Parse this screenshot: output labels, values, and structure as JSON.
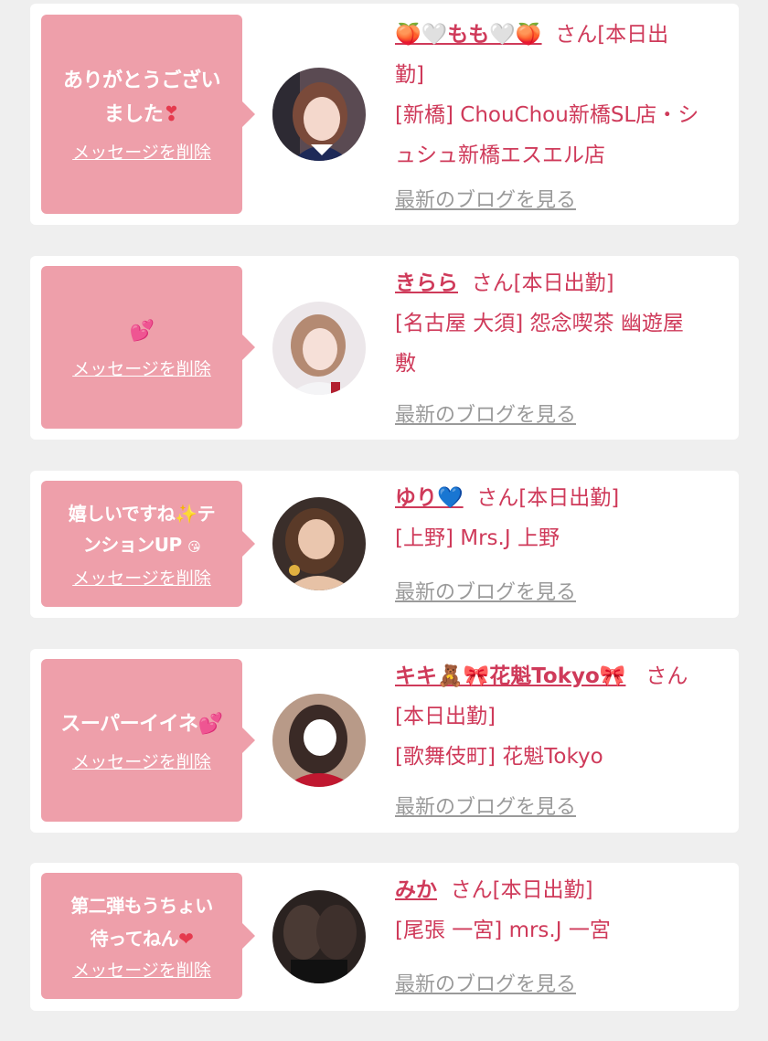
{
  "delete_label": "メッセージを削除",
  "blog_label": "最新のブログを見る",
  "san_label": "さん",
  "cards": [
    {
      "message_line1": "ありがとうござい",
      "message_line2": "ました",
      "message_emoji": "❣",
      "name": "🍑🤍もも🤍🍑",
      "status": "[本日出",
      "status2": "勤]",
      "shop_line1": "[新橋] ChouChou新橋SL店・シ",
      "shop_line2": "ュシュ新橋エスエル店",
      "avatar_icon": "avatar-photo-icon"
    },
    {
      "message_emoji": "💕",
      "name": "きらら",
      "status": "[本日出勤]",
      "shop_line1": "[名古屋 大須] 怨念喫茶 幽遊屋",
      "shop_line2": "敷",
      "avatar_icon": "avatar-photo-icon"
    },
    {
      "message_line1": "嬉しいですね",
      "message_emoji1": "✨",
      "message_line1b": "テ",
      "message_line2": "ンションUP",
      "message_emoji2": "😘",
      "name": "ゆり",
      "name_emoji": "💙",
      "status": "[本日出勤]",
      "shop_line1": "[上野] Mrs.J 上野",
      "avatar_icon": "avatar-photo-icon"
    },
    {
      "message_line1": "スーパーイイネ",
      "message_emoji": "💕",
      "name": "キキ🧸🎀花魁Tokyo🎀",
      "status": "",
      "status2": "[本日出勤]",
      "shop_line1": "[歌舞伎町] 花魁Tokyo",
      "avatar_icon": "avatar-photo-icon"
    },
    {
      "message_line1": "第二弾もうちょい",
      "message_line2": "待ってねん",
      "message_emoji": "❤",
      "name": "みか",
      "status": "[本日出勤]",
      "shop_line1": "[尾張 一宮] mrs.J 一宮",
      "avatar_icon": "avatar-photo-icon"
    }
  ]
}
